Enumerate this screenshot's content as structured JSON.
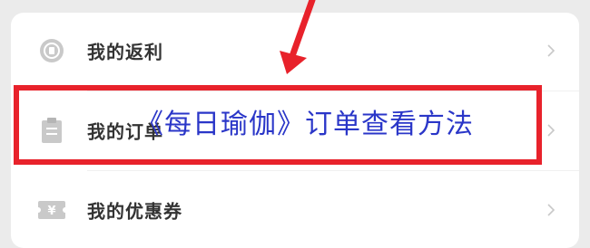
{
  "menu": {
    "items": [
      {
        "label": "我的返利",
        "icon": "rebate-coin-icon"
      },
      {
        "label": "我的订单",
        "icon": "clipboard-icon"
      },
      {
        "label": "我的优惠券",
        "icon": "coupon-icon"
      }
    ]
  },
  "overlay": {
    "title": "《每日瑜伽》订单查看方法"
  },
  "colors": {
    "highlight": "#e8222b",
    "overlay_text": "#2a36c8",
    "label_text": "#333333"
  }
}
